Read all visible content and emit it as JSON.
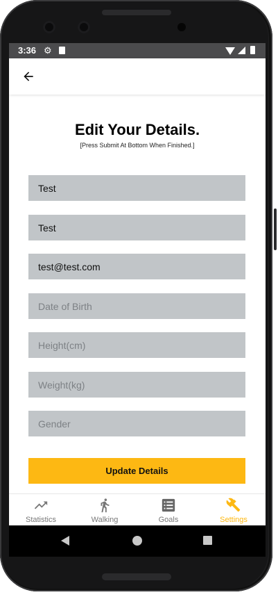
{
  "status_bar": {
    "time": "3:36",
    "icons": [
      "gear-icon",
      "sd-card-icon",
      "wifi-icon",
      "cell-signal-icon",
      "battery-icon"
    ]
  },
  "app_bar": {
    "back_icon": "arrow-left-icon"
  },
  "header": {
    "title": "Edit Your Details.",
    "subtitle": "[Press Submit At Bottom When Finished.]"
  },
  "form": {
    "first_name": {
      "value": "Test",
      "placeholder": ""
    },
    "last_name": {
      "value": "Test",
      "placeholder": ""
    },
    "email": {
      "value": "test@test.com",
      "placeholder": ""
    },
    "date_of_birth": {
      "value": "",
      "placeholder": "Date of Birth"
    },
    "height": {
      "value": "",
      "placeholder": "Height(cm)"
    },
    "weight": {
      "value": "",
      "placeholder": "Weight(kg)"
    },
    "gender": {
      "value": "",
      "placeholder": "Gender"
    },
    "submit_label": "Update Details"
  },
  "bottom_nav": {
    "items": [
      {
        "label": "Statistics",
        "icon": "trending-up-icon",
        "active": false
      },
      {
        "label": "Walking",
        "icon": "walking-person-icon",
        "active": false
      },
      {
        "label": "Goals",
        "icon": "list-icon",
        "active": false
      },
      {
        "label": "Settings",
        "icon": "tools-icon",
        "active": true
      }
    ]
  },
  "colors": {
    "accent": "#fdb813",
    "field_background": "#c1c5c8",
    "status_bar": "#4b4b4d"
  }
}
